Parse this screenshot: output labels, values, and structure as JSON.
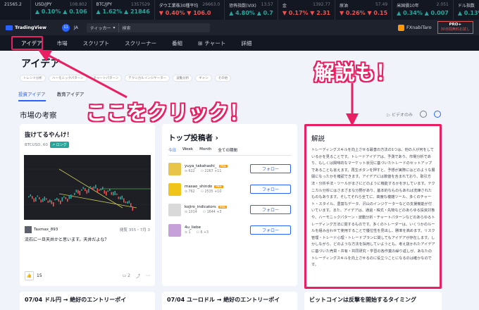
{
  "ticker": [
    {
      "name": "21565.2",
      "price": "",
      "change": "",
      "dir": "up"
    },
    {
      "name": "USD/JPY",
      "price": "108.802",
      "change": "▲ 0.10% ▲ 0.106",
      "dir": "up"
    },
    {
      "name": "BTC/JPY",
      "price": "1357529",
      "change": "▲ 1.62% ▲ 21846",
      "dir": "up"
    },
    {
      "name": "ダウ工業株30種平均",
      "price": "26663.0",
      "change": "▼ 0.40% ▼ 106.0",
      "dir": "dn"
    },
    {
      "name": "恐怖指数(VIX)",
      "price": "13.57",
      "change": "▲ 4.80% ▲ 0.7",
      "dir": "up"
    },
    {
      "name": "金",
      "price": "1392.77",
      "change": "▼ 0.17% ▼ 2.31",
      "dir": "dn"
    },
    {
      "name": "原油",
      "price": "57.49",
      "change": "▼ 0.26% ▼ 0.15",
      "dir": "dn"
    },
    {
      "name": "米国債10年",
      "price": "2.051",
      "change": "▲ 0.34% ▲ 0.007",
      "dir": "up"
    },
    {
      "name": "ドル指数",
      "price": "",
      "change": "▲ 0.13% ▲ 0.13",
      "dir": "up"
    }
  ],
  "header": {
    "logo": "TradingView",
    "badge": "11",
    "lang": "JA",
    "search_dropdown": "ティッカー",
    "search_placeholder": "検索",
    "username": "FXnabiTaro",
    "pro_label": "PRO+",
    "pro_sub": "30日間無料お試し"
  },
  "nav": [
    "アイデア",
    "市場",
    "スクリプト",
    "スクリーナー",
    "番組",
    "チャート",
    "詳細"
  ],
  "page": {
    "title": "アイデア",
    "chips": [
      "トレンド分析",
      "ハーモニックパターン",
      "チャートパターン",
      "テクニカルインジケーター",
      "波動分析",
      "ギャン",
      "その他"
    ],
    "subtabs": [
      "投資アイデア",
      "教育アイデア"
    ],
    "section_title": "市場の考察",
    "video_only": "ビデオのみ"
  },
  "card1": {
    "title": "抜けてるやんけ！",
    "symbol": "BTCUSD, 60",
    "position": "ロング",
    "author": "Taxmax_893",
    "author_meta": "閲覧 355・7月 3",
    "desc": "流石に一旦天井かと思います。天井だよな？",
    "likes": "15",
    "comments": "2"
  },
  "card2": {
    "title": "トップ投稿者 ›",
    "tabs": [
      "今日",
      "Week",
      "Month",
      "全ての期間"
    ],
    "traders": [
      {
        "name": "yuya_takahashi_",
        "ideas": "622",
        "followers": "2267 +11"
      },
      {
        "name": "masao_shindo",
        "ideas": "762",
        "followers": "2535 +10"
      },
      {
        "name": "kojiro_indicators",
        "ideas": "1014",
        "followers": "1644 +3"
      },
      {
        "name": "4u_liebe",
        "ideas": "1",
        "followers": "6 +3"
      }
    ],
    "follow_label": "フォロー",
    "pro_badge": "PRO"
  },
  "card3": {
    "title": "解説",
    "body": "トレーディングスキルを向上させる最善の方法の1つは、他の人が何をしているかを見ることです。トレードアイデアは、予測であり、市場分析であり、もしくは興味的なマーケット状況に基づいたトレードのセットアップであることも言えます。再生ボタンを押すと、予想が実際にはどのような展開になったかを確認できます。アイデアには数値を含まれており、取引方法・分析手法・ツールがまさにどのように機能するかを示しています。テクニカル分析にはさまざまな分野があり、基本的なものもあれば洗練されたものもあります。そしてそれら全てに、高度な複雑ツール、多くのチャート・スタイル、豊富なデータ、沢山のインジケーターなどの支援機能が付いています。また、アイデアは、通過・株式・先物などのあらゆる投資対象や、ハーモニックパターン・波動分析・チャートパターンなどのあらゆるトレーディング方法に関するものです。多くのトレーダーは、いくつかのルールを組み合わせて使用することで優位性を見出し、勝率を高めます。リスク管理・トレード心理・トレードプランに関してもアイデアが存在します。しかしながら、どのような方法を採用していようとも、考え抜かれたアイデアに基づいた売買・共有・共同研究・学習の各作業の繰り返しが、あなたのトレーディングスキルを向上させるのに役立つことになるのは確かなのです。"
  },
  "bottom": [
    "07/04 ドル円 → 絶好のエントリーポイ",
    "07/04 ユーロドル → 絶好のエントリーポイ",
    "ビットコインは反撃を開始するタイミング"
  ],
  "annotations": {
    "click": "ここをクリック！",
    "kaisetsu": "解説も！"
  },
  "colors": {
    "accent": "#2962ff",
    "highlight": "#e91e63",
    "up": "#26a69a",
    "down": "#ef5350"
  }
}
